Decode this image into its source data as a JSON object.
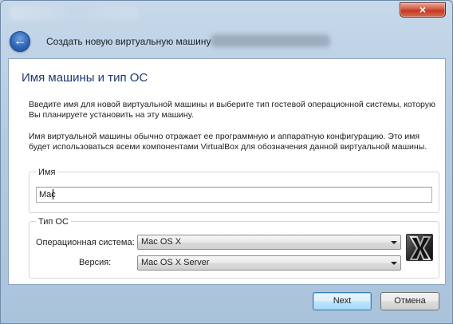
{
  "window": {
    "close_glyph": "×"
  },
  "header": {
    "title": "Создать новую виртуальную машину",
    "back_glyph": "←"
  },
  "page": {
    "section_title": "Имя машины и тип ОС",
    "paragraph1": "Введите имя для новой виртуальной машины и выберите тип гостевой операционной системы, которую Вы планируете установить на эту машину.",
    "paragraph2": "Имя виртуальной машины обычно отражает ее программную и аппаратную конфигурацию. Это имя будет использоваться всеми компонентами VirtualBox для обозначения данной виртуальной машины."
  },
  "name_group": {
    "legend": "Имя",
    "value": "Mac"
  },
  "os_group": {
    "legend": "Тип ОС",
    "os_label": "Операционная система:",
    "os_value": "Mac OS X",
    "version_label": "Версия:",
    "version_value": "Mac OS X Server"
  },
  "footer": {
    "next_label": "Next",
    "cancel_label": "Отмена"
  },
  "colors": {
    "section_title": "#1e3a70",
    "accent_blue": "#2f66b8",
    "close_red": "#c13a22"
  },
  "icons": {
    "back": "back-arrow-icon",
    "close": "close-icon",
    "os_logo": "mac-os-x-logo-icon",
    "dropdown": "chevron-down-icon"
  }
}
